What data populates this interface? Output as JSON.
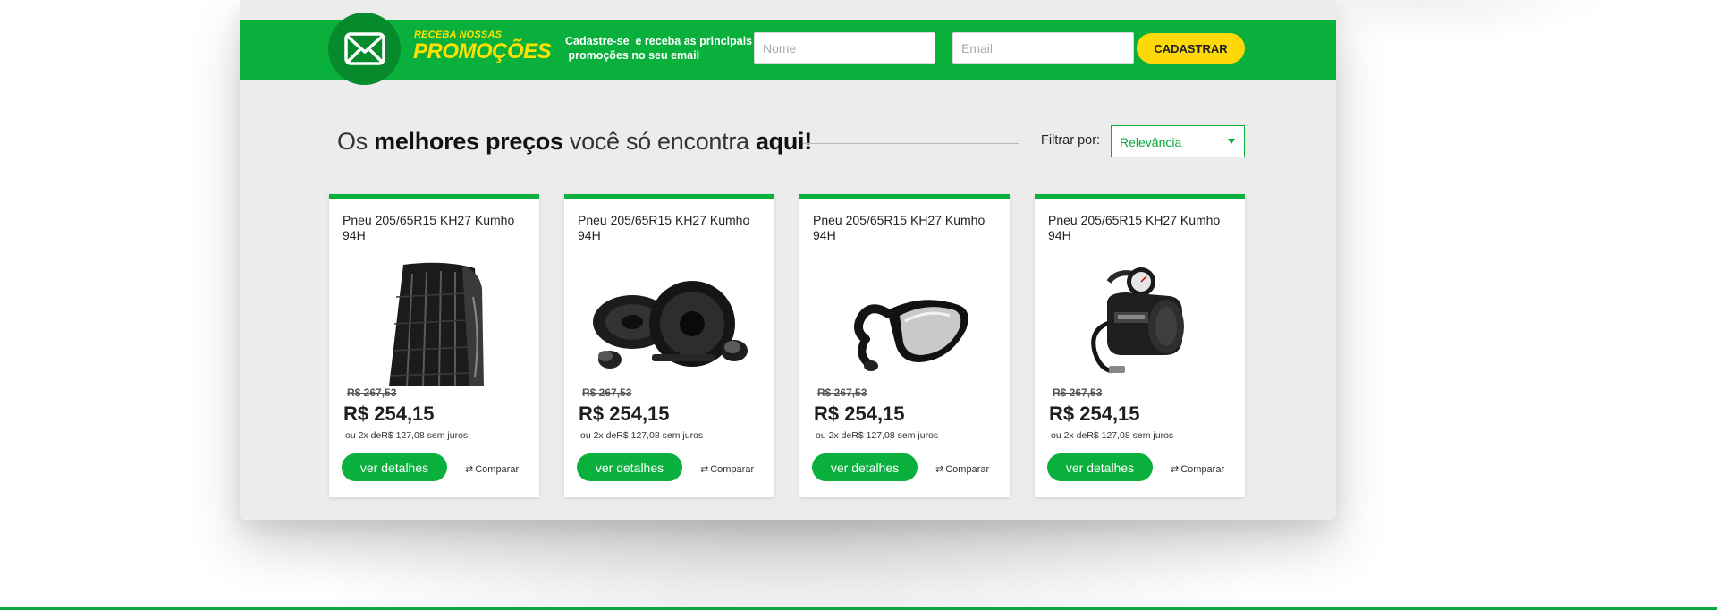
{
  "newsletter": {
    "promo_small": "RECEBA NOSSAS",
    "promo_big": "PROMOÇÕES",
    "text_line1": "Cadastre-se  e receba as principais",
    "text_line2": " promoções no seu email",
    "name_placeholder": "Nome",
    "email_placeholder": "Email",
    "submit_label": "CADASTRAR",
    "icon": "envelope-icon"
  },
  "heading": {
    "part1": "Os ",
    "bold1": "melhores preços",
    "part2": " você só encontra ",
    "bold2": "aqui!"
  },
  "filter": {
    "label": "Filtrar por:",
    "selected": "Relevância"
  },
  "products": [
    {
      "title": "Pneu 205/65R15 KH27 Kumho 94H",
      "old_price": "R$ 267,53",
      "price": "R$ 254,15",
      "installments": "ou 2x deR$ 127,08 sem juros",
      "details_label": "ver detalhes",
      "compare_label": "Comparar",
      "image": "tire-image"
    },
    {
      "title": "Pneu 205/65R15 KH27 Kumho 94H",
      "old_price": "R$ 267,53",
      "price": "R$ 254,15",
      "installments": "ou 2x deR$ 127,08 sem juros",
      "details_label": "ver detalhes",
      "compare_label": "Comparar",
      "image": "speakers-image"
    },
    {
      "title": "Pneu 205/65R15 KH27 Kumho 94H",
      "old_price": "R$ 267,53",
      "price": "R$ 254,15",
      "installments": "ou 2x deR$ 127,08 sem juros",
      "details_label": "ver detalhes",
      "compare_label": "Comparar",
      "image": "mirror-image"
    },
    {
      "title": "Pneu 205/65R15 KH27 Kumho 94H",
      "old_price": "R$ 267,53",
      "price": "R$ 254,15",
      "installments": "ou 2x deR$ 127,08 sem juros",
      "details_label": "ver detalhes",
      "compare_label": "Comparar",
      "image": "air-compressor-image"
    }
  ],
  "colors": {
    "green": "#09b03b",
    "dark_green": "#078a2c",
    "yellow": "#ffd80a",
    "panel_bg": "#ececec"
  }
}
